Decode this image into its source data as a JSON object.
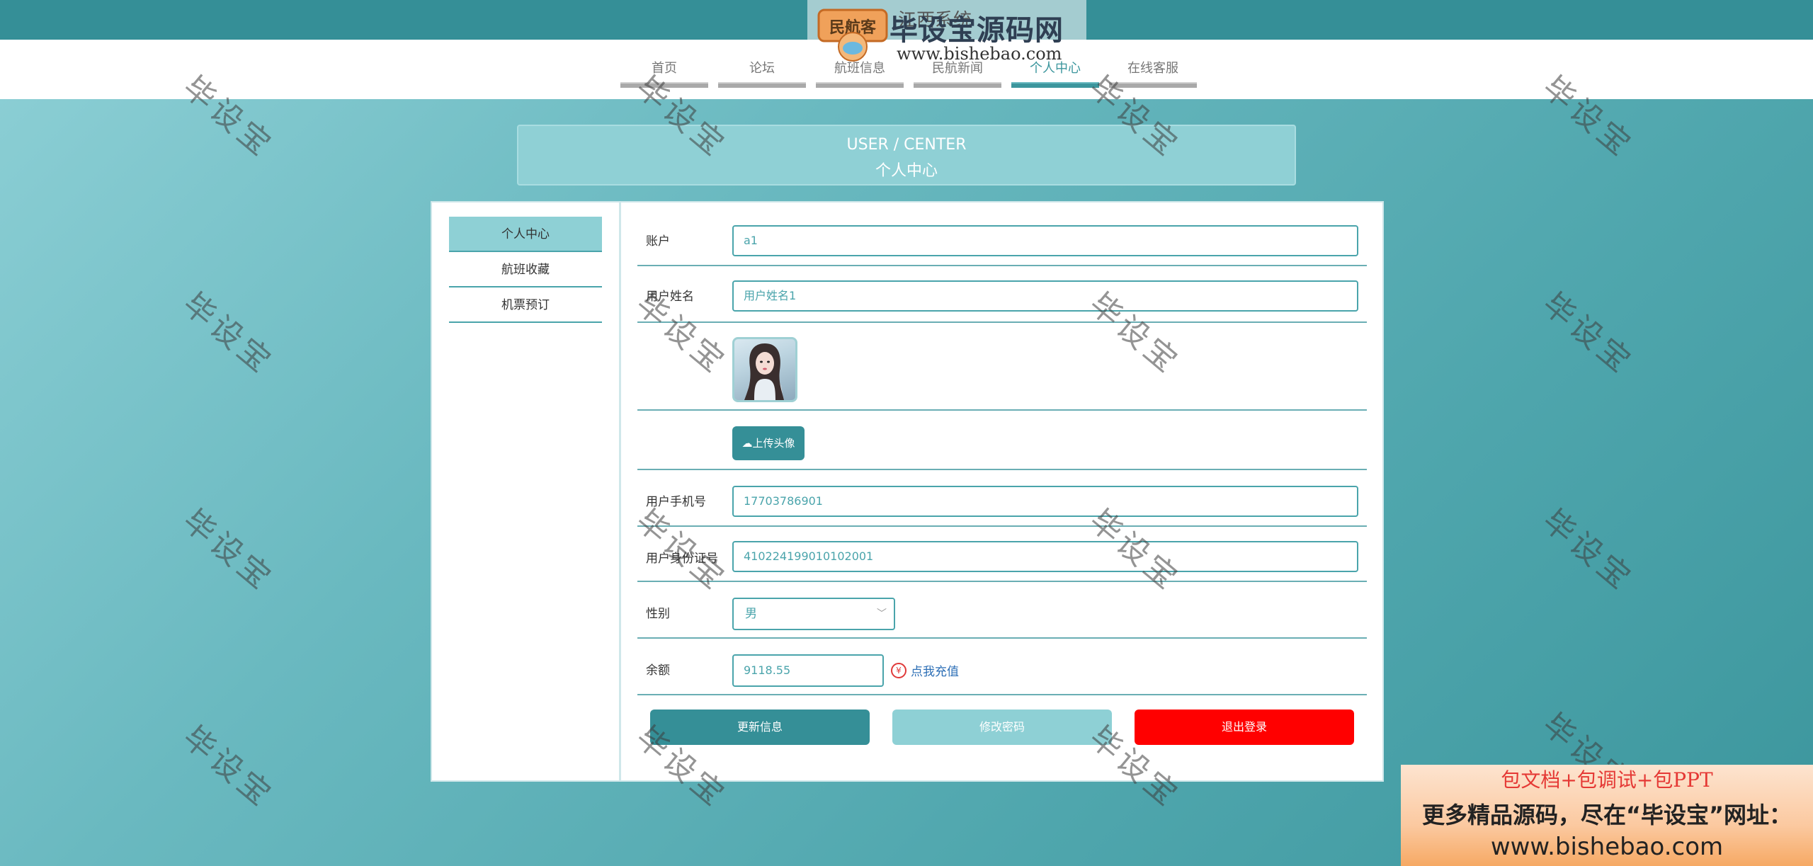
{
  "header": {
    "system_title": "江西系统",
    "logo_title": "毕设宝源码网",
    "logo_badge": "民航客",
    "logo_url": "www.bishebao.com"
  },
  "nav": {
    "items": [
      {
        "label": "首页"
      },
      {
        "label": "论坛"
      },
      {
        "label": "航班信息"
      },
      {
        "label": "民航新闻"
      },
      {
        "label": "个人中心"
      },
      {
        "label": "在线客服"
      }
    ],
    "active_index": 4
  },
  "banner": {
    "en": "USER / CENTER",
    "cn": "个人中心"
  },
  "sidebar": {
    "items": [
      {
        "label": "个人中心"
      },
      {
        "label": "航班收藏"
      },
      {
        "label": "机票预订"
      }
    ]
  },
  "form": {
    "account": {
      "label": "账户",
      "value": "a1"
    },
    "username": {
      "label": "用户姓名",
      "value": "用户姓名1"
    },
    "upload_label": "上传头像",
    "phone": {
      "label": "用户手机号",
      "value": "17703786901"
    },
    "id_card": {
      "label": "用户身份证号",
      "value": "410224199010102001"
    },
    "gender": {
      "label": "性别",
      "value": "男"
    },
    "balance": {
      "label": "余额",
      "value": "9118.55",
      "recharge": "点我充值"
    }
  },
  "actions": {
    "update": "更新信息",
    "change_password": "修改密码",
    "logout": "退出登录"
  },
  "watermark": "毕设宝",
  "promo": {
    "line1": "包文档+包调试+包PPT",
    "line2": "更多精品源码，尽在“毕设宝”网址：",
    "line3": "www.bishebao.com"
  },
  "colors": {
    "primary": "#358f97",
    "light": "#8ed0d5",
    "logout": "#ff0000"
  }
}
